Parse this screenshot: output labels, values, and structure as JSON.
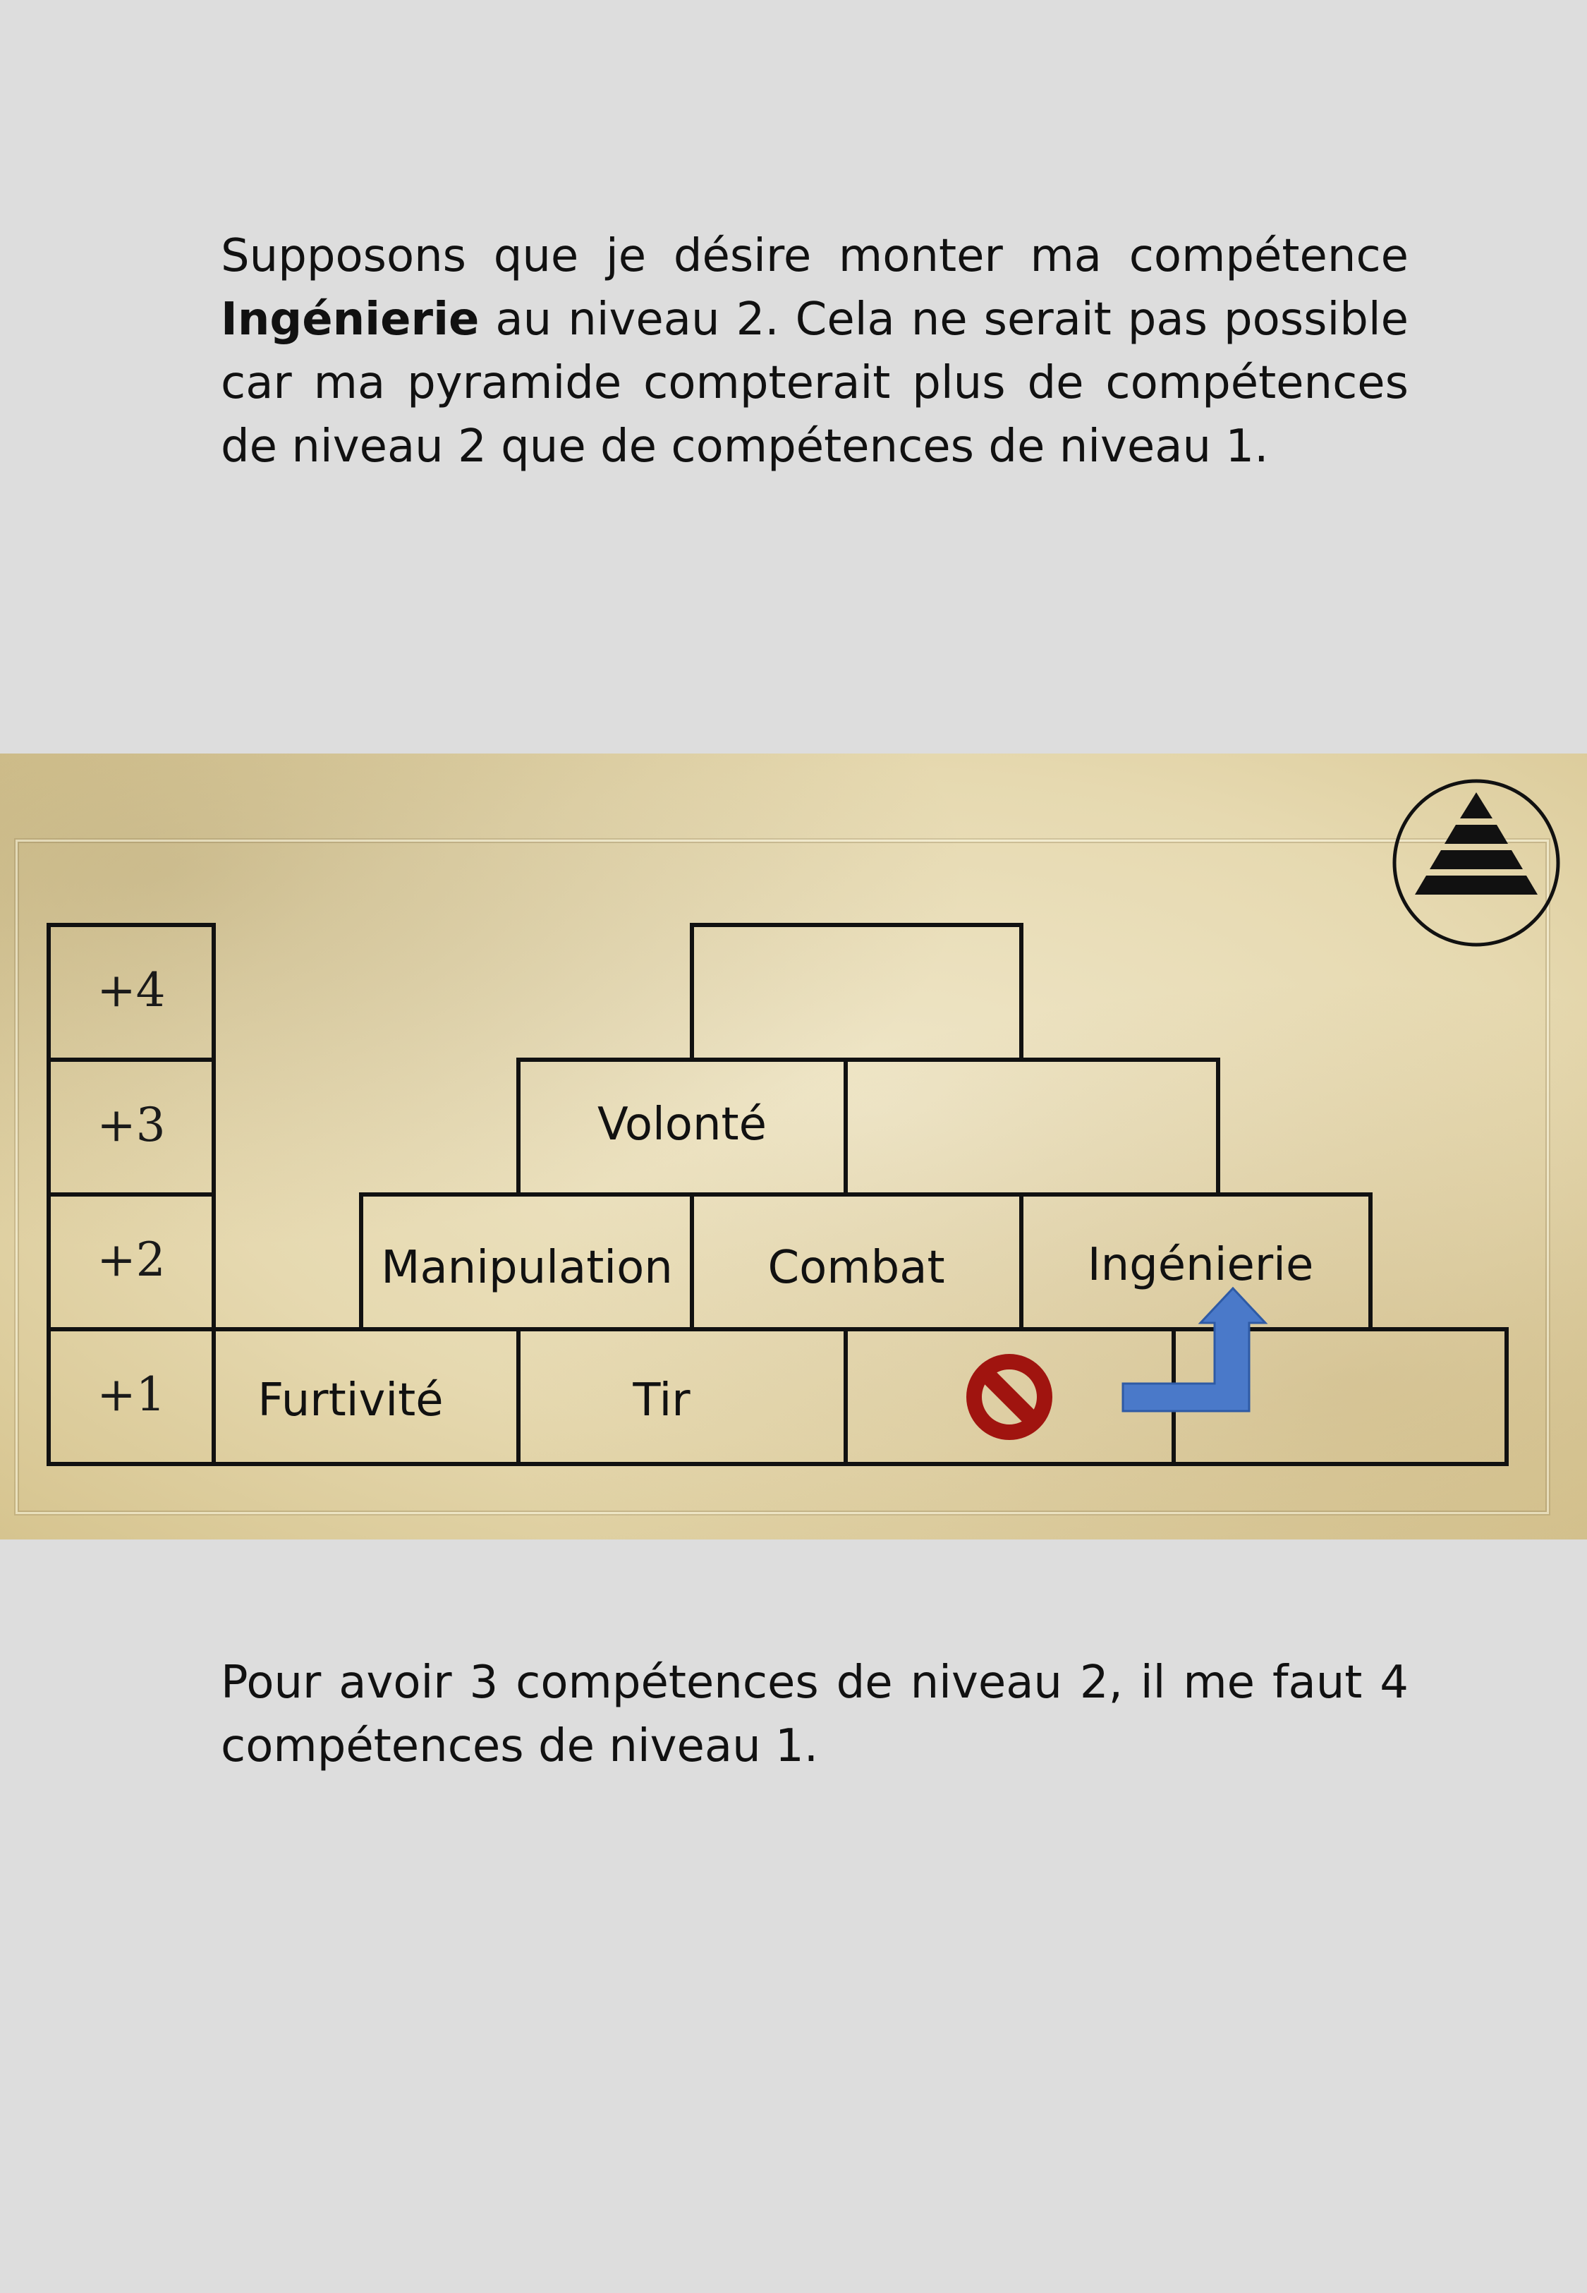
{
  "paragraph1": {
    "part1": "Supposons que je désire monter ma compétence ",
    "bold": "Ingénierie",
    "part2": " au niveau 2. Cela ne serait pas possible car ma pyramide compterait plus de compétences de niveau 2 que de compétences de niveau 1."
  },
  "paragraph2": "Pour avoir 3 compétences de niveau 2, il me faut 4 compétences de niveau 1.",
  "levels": [
    "+4",
    "+3",
    "+2",
    "+1"
  ],
  "skills": {
    "level3": [
      "Volonté",
      ""
    ],
    "level2": [
      "Manipulation",
      "Combat",
      "Ingénierie"
    ],
    "level1": [
      "Furtivité",
      "Tir",
      "",
      ""
    ]
  },
  "icons": {
    "forbidden": "forbidden-icon",
    "arrow": "up-arrow-icon",
    "logo": "pyramid-logo-icon"
  },
  "colors": {
    "forbidden": "#a0140f",
    "arrow": "#4a79c9",
    "text": "#111111"
  }
}
